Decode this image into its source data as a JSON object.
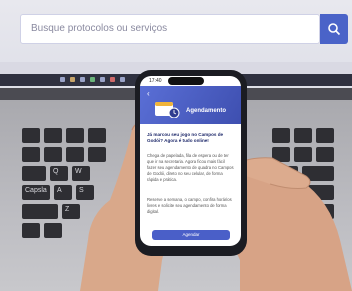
{
  "laptop": {
    "search_placeholder": "Busque protocolos ou serviços",
    "keyboard_rows": [
      [
        "",
        "",
        "",
        "",
        "",
        "",
        "",
        "",
        "",
        "",
        ""
      ],
      [
        "",
        "",
        "",
        "",
        "",
        "",
        "",
        "",
        "",
        "",
        ""
      ],
      [
        "Q",
        "W",
        "",
        "",
        "",
        "",
        "",
        "",
        "",
        "",
        ""
      ],
      [
        "Capsla",
        "A",
        "S",
        "",
        "",
        "",
        "",
        "",
        "",
        "",
        ""
      ],
      [
        "",
        "Z",
        "",
        "",
        "",
        "",
        "",
        "",
        "",
        "",
        ""
      ]
    ]
  },
  "phone": {
    "status_time": "17:40",
    "app_title": "Agendamento",
    "question": "Já marcou seu jogo no Campos de Godói? Agora é tudo online!",
    "answer": "Chega de papelada, fila de espera ou de ter que ir na secretaria. Agora ficou mais fácil fazer seu agendamento de quadra no Campos de Godói, direto no seu celular, de forma rápida e prática.",
    "answer2": "Reserve a semana, o campo, confira horários livres e solicite seu agendamento de forma digital.",
    "cta_label": "Agendar"
  },
  "colors": {
    "accent": "#4a5fc8",
    "header_dark": "#3e4fb0",
    "question_text": "#1f2a6b"
  }
}
